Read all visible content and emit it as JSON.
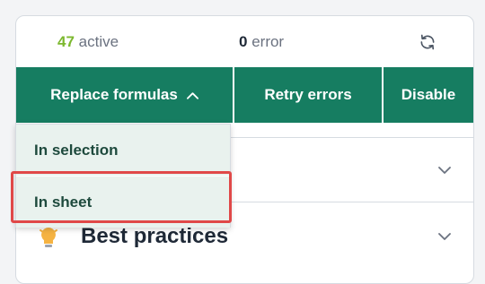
{
  "stats": {
    "active_count": "47",
    "active_label": "active",
    "error_count": "0",
    "error_label": "error",
    "refresh_icon": "refresh-icon"
  },
  "toolbar": {
    "replace_label": "Replace formulas",
    "retry_label": "Retry errors",
    "disable_label": "Disable"
  },
  "dropdown": {
    "items": [
      {
        "label": "In selection"
      },
      {
        "label": "In sheet"
      }
    ]
  },
  "sections": [
    {
      "title": ""
    },
    {
      "title": "Best practices",
      "icon": "light-bulb-icon"
    }
  ],
  "colors": {
    "brand_green": "#167d61",
    "active_green": "#7cb82f",
    "highlight_red": "#e04848"
  }
}
